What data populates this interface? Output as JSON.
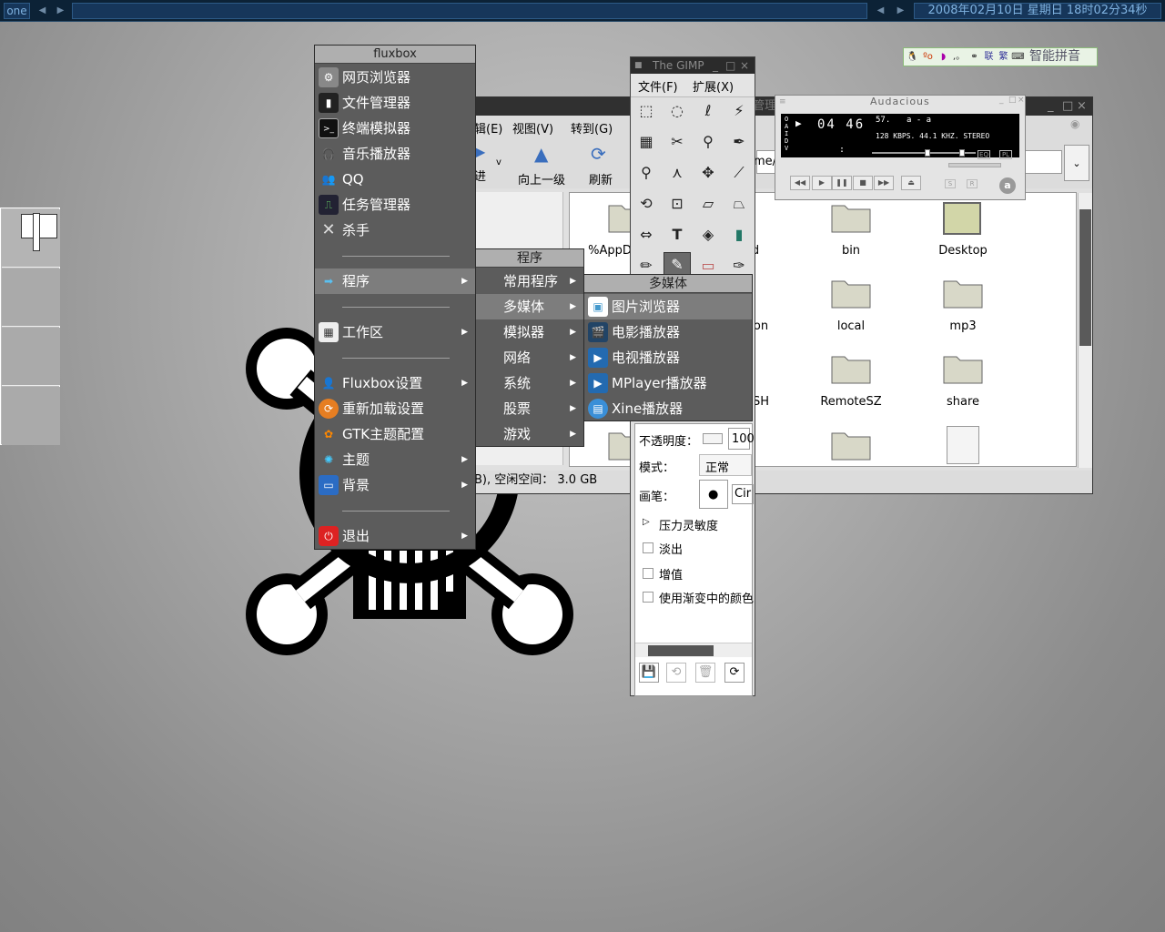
{
  "toolbar": {
    "workspace": "one",
    "clock": "2008年02月10日 星期日 18时02分34秒",
    "prev_arrow": "◀",
    "next_arrow": "▶"
  },
  "ime": {
    "label": "智能拼音",
    "icons": [
      "penguin-icon",
      "config-icon",
      "moon-icon",
      "punct-icon",
      "connect-icon",
      "lian",
      "fan",
      "keyboard-icon"
    ],
    "lian": "联",
    "fan": "繁"
  },
  "file_manager": {
    "title_partial": "管理",
    "menu": [
      "辑(E)",
      "视图(V)",
      "转到(G)"
    ],
    "toolbar": {
      "back": "进",
      "up": "向上一级",
      "refresh": "刷新"
    },
    "location_partial": "me/",
    "files": [
      {
        "name": "%AppD"
      },
      {
        "name": "d"
      },
      {
        "name": "bin"
      },
      {
        "name": "Desktop"
      },
      {
        "name": "on"
      },
      {
        "name": "local"
      },
      {
        "name": "mp3"
      },
      {
        "name": "SH"
      },
      {
        "name": "RemoteSZ"
      },
      {
        "name": "share"
      }
    ],
    "status": "B), 空闲空间： 3.0 GB"
  },
  "gimp": {
    "title": "The GIMP",
    "menu": [
      "文件(F)",
      "扩展(X)"
    ],
    "opacity_label": "不透明度：",
    "opacity_value": "100",
    "mode_label": "模式：",
    "mode_value": "正常",
    "brush_label": "画笔：",
    "brush_value": "Cir",
    "pressure": "压力灵敏度",
    "fade": "淡出",
    "incremental": "增值",
    "gradient": "使用渐变中的颜色"
  },
  "audacious": {
    "logo": "Audacious",
    "time": "04 46",
    "track_num": "57.",
    "track_title": "a - a",
    "info": "128 KBPS. 44.1 KHZ. STEREO",
    "colon": ":"
  },
  "menu_main": {
    "title": "fluxbox",
    "items": [
      {
        "label": "网页浏览器"
      },
      {
        "label": "文件管理器"
      },
      {
        "label": "终端模拟器"
      },
      {
        "label": "音乐播放器"
      },
      {
        "label": "QQ"
      },
      {
        "label": "任务管理器"
      },
      {
        "label": "杀手"
      },
      {
        "label": "程序"
      },
      {
        "label": "工作区"
      },
      {
        "label": "Fluxbox设置"
      },
      {
        "label": "重新加载设置"
      },
      {
        "label": "GTK主题配置"
      },
      {
        "label": "主题"
      },
      {
        "label": "背景"
      },
      {
        "label": "退出"
      }
    ]
  },
  "menu_programs": {
    "title": "程序",
    "items": [
      {
        "label": "常用程序"
      },
      {
        "label": "多媒体"
      },
      {
        "label": "模拟器"
      },
      {
        "label": "网络"
      },
      {
        "label": "系统"
      },
      {
        "label": "股票"
      },
      {
        "label": "游戏"
      }
    ]
  },
  "menu_multimedia": {
    "title": "多媒体",
    "items": [
      {
        "label": "图片浏览器"
      },
      {
        "label": "电影播放器"
      },
      {
        "label": "电视播放器"
      },
      {
        "label": "MPlayer播放器"
      },
      {
        "label": "Xine播放器"
      }
    ]
  }
}
